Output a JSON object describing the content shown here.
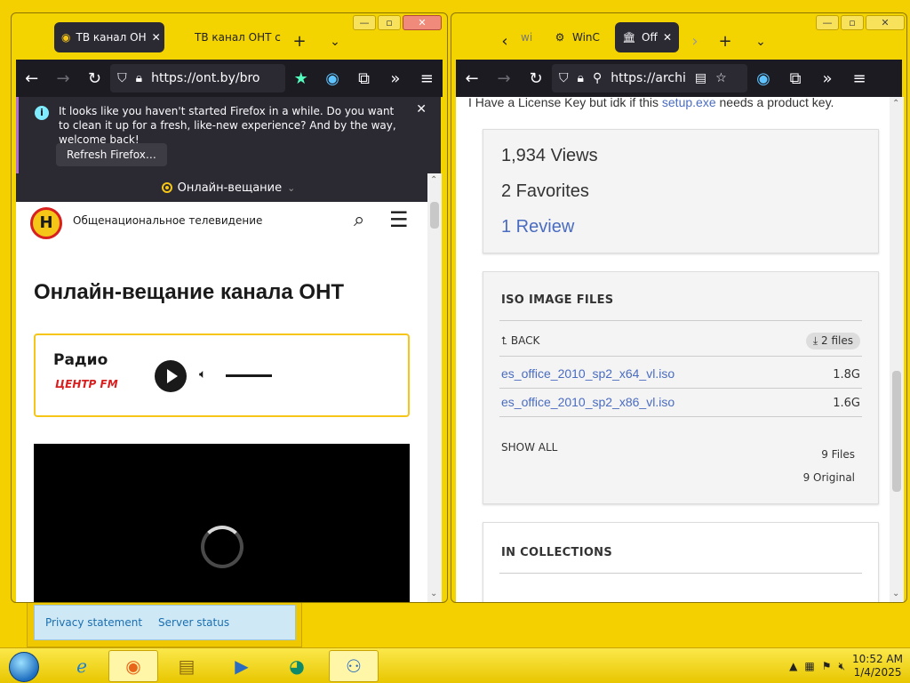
{
  "left_window": {
    "tabs": [
      {
        "label": "ТВ канал ОН",
        "icon": "ont-logo-icon",
        "active": true
      },
      {
        "label": "ТВ канал ОНТ с",
        "icon": "",
        "active": false
      }
    ],
    "url": "https://ont.by/bro",
    "notification": {
      "message": "It looks like you haven't started Firefox in a while. Do you want to clean it up for a fresh, like-new experience? And by the way, welcome back!",
      "button": "Refresh Firefox…"
    },
    "broadcast_menu": "Онлайн-вещание",
    "page": {
      "site_name": "Общенациональное телевидение",
      "heading": "Онлайн-вещание канала ОНТ",
      "radio_label": "Радио",
      "radio_brand": "ЦЕНТР FM"
    }
  },
  "right_window": {
    "tabs": [
      {
        "label": "wi",
        "icon": "",
        "active": false
      },
      {
        "label": "WinC",
        "icon": "gear-icon",
        "active": false
      },
      {
        "label": "Off",
        "icon": "archive-icon",
        "active": true
      }
    ],
    "url": "https://archi",
    "intro_text_before": "I Have a License Key but idk if this ",
    "intro_link": "setup.exe",
    "intro_text_after": " needs a product key.",
    "stats": {
      "views": "1,934 Views",
      "favorites": "2 Favorites",
      "reviews": "1 Review"
    },
    "iso_section": {
      "title": "ISO IMAGE FILES",
      "back": "BACK",
      "files_badge": "2 files",
      "files": [
        {
          "name": "es_office_2010_sp2_x64_vl.iso",
          "size": "1.8G"
        },
        {
          "name": "es_office_2010_sp2_x86_vl.iso",
          "size": "1.6G"
        }
      ],
      "show_all": "SHOW ALL",
      "total_files": "9 Files",
      "original": "9 Original"
    },
    "collections_title": "IN COLLECTIONS"
  },
  "background_window": {
    "links": [
      "Privacy statement",
      "Server status"
    ]
  },
  "taskbar": {
    "time": "10:52 AM",
    "date": "1/4/2025"
  }
}
